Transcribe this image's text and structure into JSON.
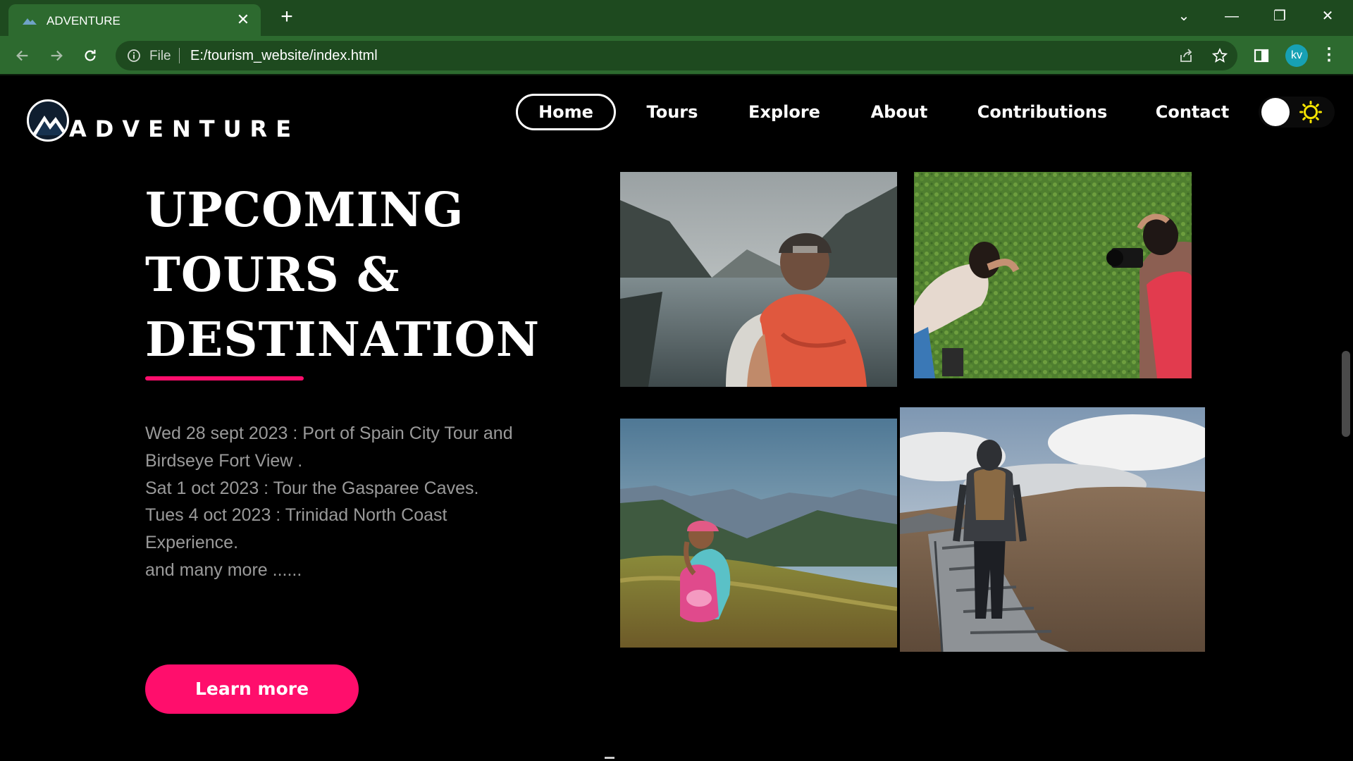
{
  "browser": {
    "tab_title": "ADVENTURE",
    "tab_close": "✕",
    "new_tab": "+",
    "omnibox": {
      "scheme_label": "File",
      "url": "E:/tourism_website/index.html"
    },
    "profile_initials": "kv",
    "window_controls": [
      "⌄",
      "—",
      "❐",
      "✕"
    ],
    "menu_glyph": "⋮"
  },
  "site": {
    "logo_text": "ADVENTURE",
    "nav": [
      {
        "label": "Home",
        "active": true
      },
      {
        "label": "Tours",
        "active": false
      },
      {
        "label": "Explore",
        "active": false
      },
      {
        "label": "About",
        "active": false
      },
      {
        "label": "Contributions",
        "active": false
      },
      {
        "label": "Contact",
        "active": false
      }
    ],
    "theme_toggle": {
      "mode": "dark",
      "icon": "sun-icon"
    }
  },
  "hero": {
    "headline_lines": [
      "UPCOMING",
      "TOURS &",
      "DESTINATION"
    ],
    "accent_color": "#ff0e6c",
    "tours_lines": [
      "Wed 28 sept 2023 : Port of Spain City Tour and",
      "Birdseye Fort View .",
      "Sat 1 oct 2023 : Tour the Gasparee Caves.",
      "Tues 4 oct 2023 : Trinidad North Coast",
      "Experience.",
      "and many more ......"
    ],
    "cta_label": "Learn more"
  },
  "gallery": [
    {
      "name": "hiker-lake-photo"
    },
    {
      "name": "photographers-hedge-photo"
    },
    {
      "name": "girl-mountains-photo"
    },
    {
      "name": "hiker-rocky-path-photo"
    }
  ],
  "colors": {
    "browser_frame": "#1e4a1f",
    "browser_toolbar": "#2d6a2f",
    "page_background": "#000000",
    "sun": "#f5e300"
  }
}
